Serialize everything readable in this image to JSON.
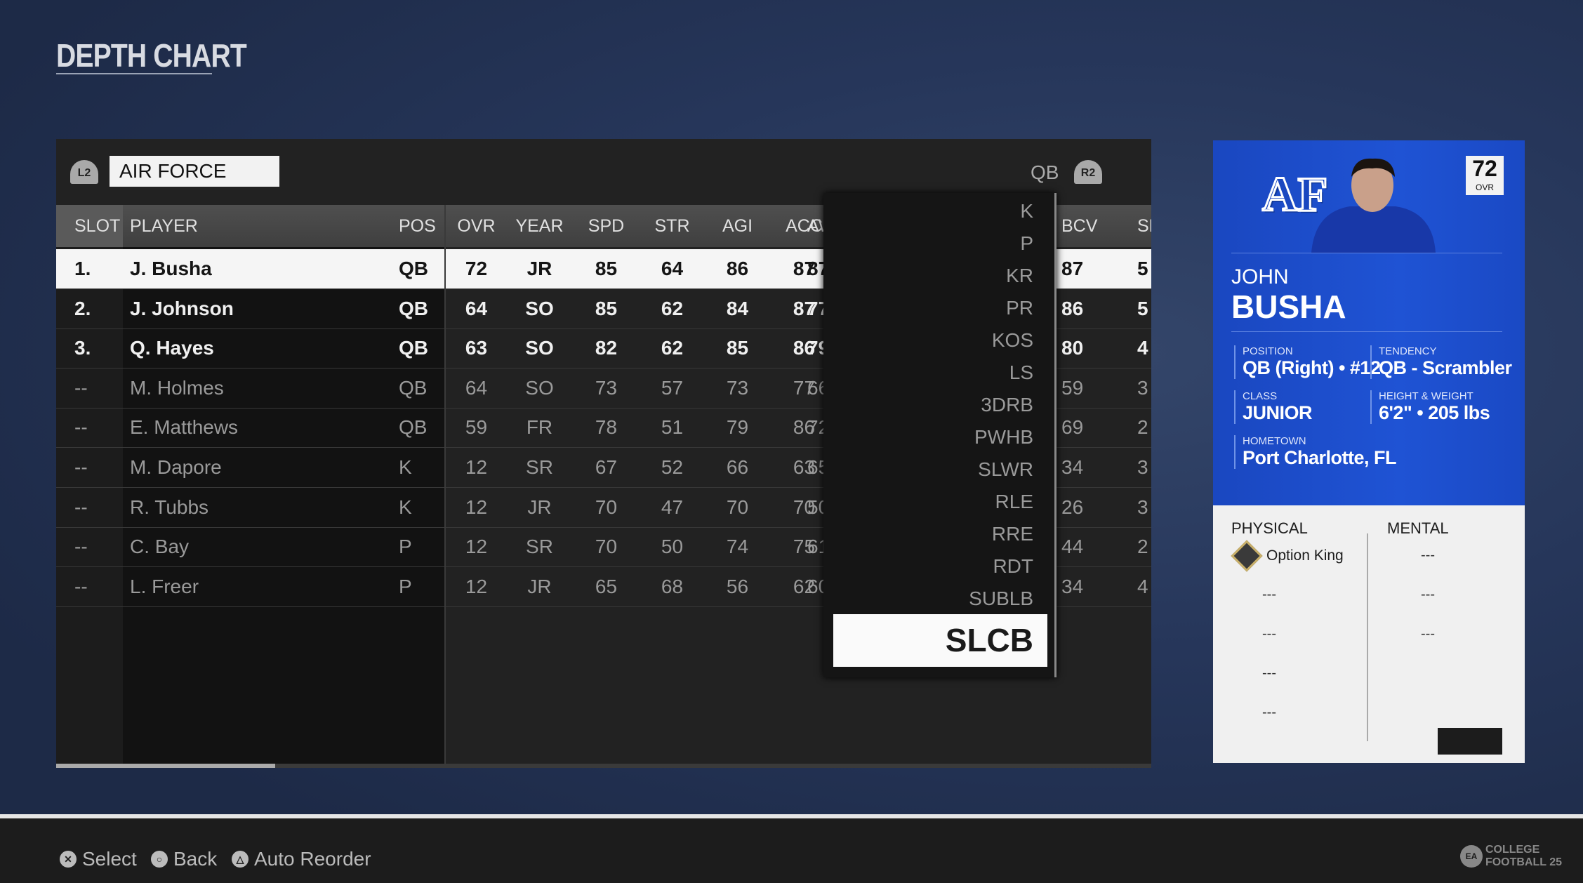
{
  "title": "DEPTH CHART",
  "team_selector": {
    "prev_button": "L2",
    "team": "AIR FORCE",
    "next_button": "R2",
    "position": "QB"
  },
  "table": {
    "columns": [
      "SLOT",
      "PLAYER",
      "POS",
      "OVR",
      "YEAR",
      "SPD",
      "STR",
      "AGI",
      "ACC",
      "AWR",
      "BCV",
      "SF"
    ],
    "rows": [
      {
        "slot": "1.",
        "player": "J. Busha",
        "pos": "QB",
        "ovr": "72",
        "year": "JR",
        "spd": "85",
        "str": "64",
        "agi": "86",
        "acc": "87",
        "awr": "87",
        "bcv": "87",
        "sf": "5",
        "state": "selected"
      },
      {
        "slot": "2.",
        "player": "J. Johnson",
        "pos": "QB",
        "ovr": "64",
        "year": "SO",
        "spd": "85",
        "str": "62",
        "agi": "84",
        "acc": "87",
        "awr": "77",
        "bcv": "86",
        "sf": "5",
        "state": "slotted"
      },
      {
        "slot": "3.",
        "player": "Q. Hayes",
        "pos": "QB",
        "ovr": "63",
        "year": "SO",
        "spd": "82",
        "str": "62",
        "agi": "85",
        "acc": "86",
        "awr": "79",
        "bcv": "80",
        "sf": "4",
        "state": "slotted"
      },
      {
        "slot": "--",
        "player": "M. Holmes",
        "pos": "QB",
        "ovr": "64",
        "year": "SO",
        "spd": "73",
        "str": "57",
        "agi": "73",
        "acc": "77",
        "awr": "66",
        "bcv": "59",
        "sf": "3",
        "state": "unslotted"
      },
      {
        "slot": "--",
        "player": "E. Matthews",
        "pos": "QB",
        "ovr": "59",
        "year": "FR",
        "spd": "78",
        "str": "51",
        "agi": "79",
        "acc": "86",
        "awr": "72",
        "bcv": "69",
        "sf": "2",
        "state": "unslotted"
      },
      {
        "slot": "--",
        "player": "M. Dapore",
        "pos": "K",
        "ovr": "12",
        "year": "SR",
        "spd": "67",
        "str": "52",
        "agi": "66",
        "acc": "63",
        "awr": "65",
        "bcv": "34",
        "sf": "3",
        "state": "unslotted"
      },
      {
        "slot": "--",
        "player": "R. Tubbs",
        "pos": "K",
        "ovr": "12",
        "year": "JR",
        "spd": "70",
        "str": "47",
        "agi": "70",
        "acc": "70",
        "awr": "50",
        "bcv": "26",
        "sf": "3",
        "state": "unslotted"
      },
      {
        "slot": "--",
        "player": "C. Bay",
        "pos": "P",
        "ovr": "12",
        "year": "SR",
        "spd": "70",
        "str": "50",
        "agi": "74",
        "acc": "75",
        "awr": "61",
        "bcv": "44",
        "sf": "2",
        "state": "unslotted"
      },
      {
        "slot": "--",
        "player": "L. Freer",
        "pos": "P",
        "ovr": "12",
        "year": "JR",
        "spd": "65",
        "str": "68",
        "agi": "56",
        "acc": "62",
        "awr": "60",
        "bcv": "34",
        "sf": "4",
        "state": "unslotted"
      }
    ],
    "scroll_fraction": 0.2
  },
  "position_dropdown": {
    "items": [
      "K",
      "P",
      "KR",
      "PR",
      "KOS",
      "LS",
      "3DRB",
      "PWHB",
      "SLWR",
      "RLE",
      "RRE",
      "RDT",
      "SUBLB"
    ],
    "selected": "SLCB"
  },
  "player_card": {
    "ovr": "72",
    "ovr_label": "OVR",
    "team_logo": "AF",
    "first_name": "JOHN",
    "last_name": "BUSHA",
    "position_label": "POSITION",
    "position": "QB (Right) • #12",
    "tendency_label": "TENDENCY",
    "tendency": "QB - Scrambler",
    "class_label": "CLASS",
    "class": "JUNIOR",
    "hw_label": "HEIGHT & WEIGHT",
    "hw": "6'2\" • 205 lbs",
    "hometown_label": "HOMETOWN",
    "hometown": "Port Charlotte, FL",
    "physical_label": "PHYSICAL",
    "mental_label": "MENTAL",
    "physical": [
      "Option King",
      "---",
      "---",
      "---",
      "---"
    ],
    "mental": [
      "---",
      "---",
      "---"
    ],
    "brand_color": "#1f4fcf"
  },
  "footer": {
    "buttons": [
      {
        "icon": "cross",
        "label": "Select"
      },
      {
        "icon": "circle",
        "label": "Back"
      },
      {
        "icon": "triangle",
        "label": "Auto Reorder"
      }
    ],
    "logo": "EA SPORTS COLLEGE FOOTBALL 25"
  }
}
